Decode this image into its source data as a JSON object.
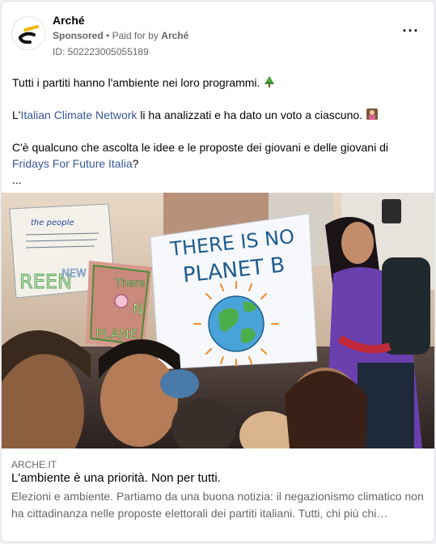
{
  "post": {
    "page_name": "Arché",
    "sponsored_label": "Sponsored",
    "separator": "•",
    "paid_for_prefix": "Paid for by",
    "paid_for_name": "Arché",
    "ad_id": "ID: 502223005055189",
    "more_label": "···"
  },
  "body": {
    "p1_text": "Tutti i partiti hanno l'ambiente nei loro programmi.",
    "p1_emoji": "tree-emoji",
    "p2_prefix": "L'",
    "p2_link": "Italian Climate Network",
    "p2_suffix": " li ha analizzati e ha dato un voto a ciascuno.",
    "p2_emoji": "classroom-emoji",
    "p3_text": "C'è qualcuno che ascolta le idee e le proposte dei giovani e delle giovani di ",
    "p3_link": "Fridays For Future Italia",
    "p3_suffix": "?",
    "see_more": "..."
  },
  "media": {
    "sign_line1": "THERE IS NO",
    "sign_line2": "PLANET B",
    "left_sign_top": "the people",
    "left_sign_green": "REEN",
    "left_sign_deal": "NEW DEAL",
    "pink_sign_line1": "There",
    "pink_sign_line2": "N",
    "pink_sign_line3": "PLANE"
  },
  "link_preview": {
    "domain": "ARCHE.IT",
    "headline": "L'ambiente è una priorità. Non per tutti.",
    "description": "Elezioni e ambiente. Partiamo da una buona notizia: il negazionismo climatico non ha cittadinanza nelle proposte elettorali dei partiti italiani. Tutti, chi più chi…"
  },
  "colors": {
    "link": "#385898",
    "secondary_text": "#65676b",
    "brand_yellow": "#f4b400"
  }
}
